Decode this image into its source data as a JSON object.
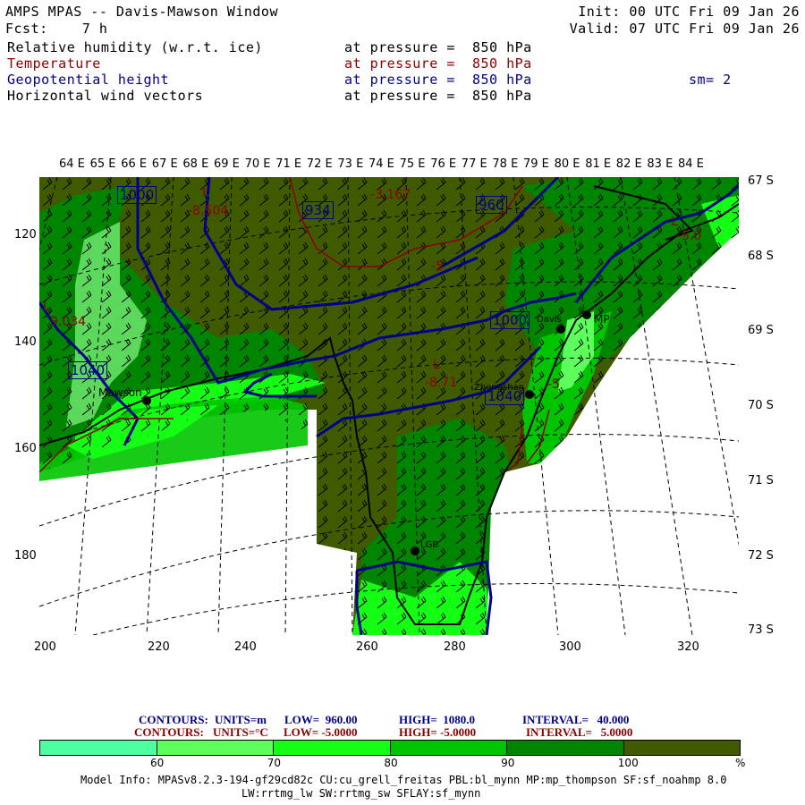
{
  "header": {
    "title": "AMPS MPAS -- Davis-Mawson Window",
    "fcst": "Fcst:    7 h",
    "init": "Init: 00 UTC Fri 09 Jan 26",
    "valid": "Valid: 07 UTC Fri 09 Jan 26"
  },
  "fields": [
    {
      "name": "Relative humidity (w.r.t. ice)",
      "level": "at pressure =  850 hPa",
      "color": "#000000"
    },
    {
      "name": "Temperature",
      "level": "at pressure =  850 hPa",
      "color": "#8b0000"
    },
    {
      "name": "Geopotential height",
      "level": "at pressure =  850 hPa",
      "color": "#00008b",
      "extra": "sm= 2"
    },
    {
      "name": "Horizontal wind vectors",
      "level": "at pressure =  850 hPa",
      "color": "#000000"
    }
  ],
  "map": {
    "lon_labels": [
      "64 E",
      "65 E",
      "66 E",
      "67 E",
      "68 E",
      "69 E",
      "70 E",
      "71 E",
      "72 E",
      "73 E",
      "74 E",
      "75 E",
      "76 E",
      "77 E",
      "78 E",
      "79 E",
      "80 E",
      "81 E",
      "82 E",
      "83 E",
      "84 E"
    ],
    "lat_labels": [
      "67 S",
      "68 S",
      "69 S",
      "70 S",
      "71 S",
      "72 S",
      "73 S"
    ],
    "y_ticks": [
      "120",
      "140",
      "160",
      "180"
    ],
    "x_ticks": [
      "200",
      "220",
      "240",
      "260",
      "280",
      "300",
      "320"
    ],
    "height_labels": [
      "1000",
      "934",
      "960",
      "1040",
      "1000",
      "1040"
    ],
    "temp_labels": [
      "L",
      "-8.504",
      "-3.167",
      "L",
      "9.034",
      "-5",
      "L",
      "-8.71",
      "-5.0",
      "-5",
      "L"
    ],
    "stations": [
      "Mawson",
      "MP",
      "Zhongshan",
      "Davis",
      "LGB"
    ]
  },
  "legend": {
    "contours_height": {
      "label": "CONTOURS:",
      "units": "UNITS=m",
      "low": "LOW=  960.00",
      "high": "HIGH=  1080.0",
      "interval": "INTERVAL=   40.000"
    },
    "contours_temp": {
      "label": "CONTOURS:",
      "units": "UNITS=°C",
      "low": "LOW= -5.0000",
      "high": "HIGH= -5.0000",
      "interval": "INTERVAL=   5.0000"
    },
    "colorbar_colors": [
      "#4dff9f",
      "#5cff5c",
      "#14ff14",
      "#00c400",
      "#008500",
      "#405a00"
    ],
    "colorbar_labels": [
      "60",
      "70",
      "80",
      "90",
      "100",
      "%"
    ]
  },
  "footer": {
    "line1": "Model Info: MPASv8.2.3-194-gf29cd82c CU:cu_grell_freitas PBL:bl_mynn MP:mp_thompson SF:sf_noahmp 8.0",
    "line2": "LW:rrtmg_lw SW:rrtmg_sw SFLAY:sf_mynn"
  }
}
